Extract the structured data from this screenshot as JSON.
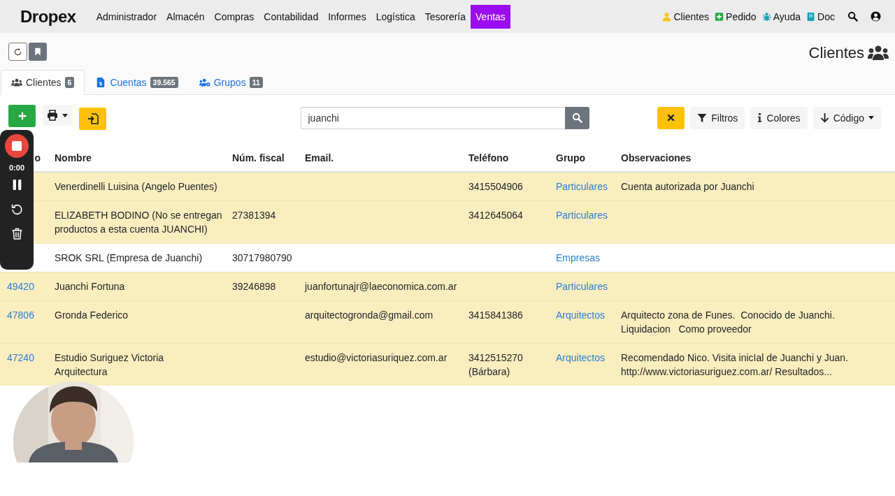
{
  "brand": {
    "name": "Dropex"
  },
  "nav": [
    {
      "label": "Administrador",
      "selected": false
    },
    {
      "label": "Almacén",
      "selected": false
    },
    {
      "label": "Compras",
      "selected": false
    },
    {
      "label": "Contabilidad",
      "selected": false
    },
    {
      "label": "Informes",
      "selected": false
    },
    {
      "label": "Logística",
      "selected": false
    },
    {
      "label": "Tesorería",
      "selected": false
    },
    {
      "label": "Ventas",
      "selected": true
    }
  ],
  "nav_right": [
    {
      "label": "Clientes",
      "kind": "person"
    },
    {
      "label": "Pedido",
      "kind": "plus"
    },
    {
      "label": "Ayuda",
      "kind": "bug"
    },
    {
      "label": "Doc",
      "kind": "book"
    }
  ],
  "page_title": "Clientes",
  "tabs": [
    {
      "label": "Clientes",
      "count": "6",
      "selected": true,
      "kind": "users"
    },
    {
      "label": "Cuentas",
      "count": "39.565",
      "selected": false,
      "kind": "file"
    },
    {
      "label": "Grupos",
      "count": "11",
      "selected": false,
      "kind": "group"
    }
  ],
  "search": {
    "value": "juanchi"
  },
  "toolbar_right": [
    {
      "label": "Filtros",
      "kind": "filter"
    },
    {
      "label": "Colores",
      "kind": "info"
    },
    {
      "label": "Código",
      "kind": "sort"
    }
  ],
  "recorder": {
    "time": "0:00"
  },
  "table": {
    "columns": [
      "o",
      "Nombre",
      "Núm. fiscal",
      "Email.",
      "Teléfono",
      "Grupo",
      "Observaciones"
    ],
    "rows": [
      {
        "highlighted": true,
        "name": "Venerdinelli Luisina (Angelo Puentes)",
        "phone": "3415504906",
        "group": "Particulares",
        "notes": "Cuenta autorizada por Juanchi"
      },
      {
        "highlighted": true,
        "name": "ELIZABETH BODINO (No se entregan\nproductos a esta cuenta JUANCHI)",
        "fiscal": "27381394",
        "phone": "3412645064",
        "group": "Particulares"
      },
      {
        "highlighted": false,
        "name": "SROK SRL (Empresa de Juanchi)",
        "fiscal": "30717980790",
        "group": "Empresas"
      },
      {
        "highlighted": true,
        "code": "49420",
        "name": "Juanchi Fortuna",
        "fiscal": "39246898",
        "email": "juanfortunajr@laeconomica.com.ar",
        "group": "Particulares"
      },
      {
        "highlighted": true,
        "code": "47806",
        "name": "Gronda Federico",
        "email": "arquitectogronda@gmail.com",
        "phone": "3415841386",
        "group": "Arquitectos",
        "notes": "Arquitecto zona de Funes.  Conocido de Juanchi.\nLiquidacion   Como proveedor"
      },
      {
        "highlighted": true,
        "code": "47240",
        "name": "Estudio Suriguez Victoria\nArquitectura",
        "email": "estudio@victoriasuriquez.com.ar",
        "phone": "3412515270\n(Bárbara)",
        "group": "Arquitectos",
        "notes": "Recomendado Nico. Visita inicIal de Juanchi y Juan.\nhttp://www.victoriasuriguez.com.ar/ Resultados..."
      }
    ]
  }
}
